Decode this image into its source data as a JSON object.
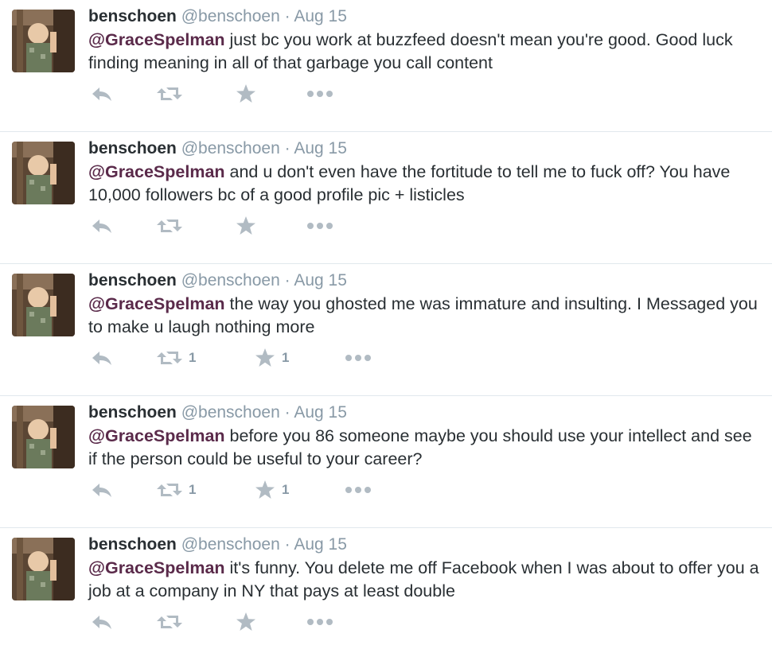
{
  "tweets": [
    {
      "fullname": "benschoen",
      "username": "@benschoen",
      "separator": "·",
      "time": "Aug 15",
      "mention": "@GraceSpelman",
      "text": " just bc you work at buzzfeed doesn't mean you're good. Good luck finding meaning in all of that garbage you call content",
      "retweet_count": "",
      "favorite_count": ""
    },
    {
      "fullname": "benschoen",
      "username": "@benschoen",
      "separator": "·",
      "time": "Aug 15",
      "mention": "@GraceSpelman",
      "text": " and u don't even have the fortitude to tell me to fuck off? You have 10,000 followers bc of a good profile pic + listicles",
      "retweet_count": "",
      "favorite_count": ""
    },
    {
      "fullname": "benschoen",
      "username": "@benschoen",
      "separator": "·",
      "time": "Aug 15",
      "mention": "@GraceSpelman",
      "text": " the way you ghosted me was immature and insulting. I Messaged you to make u laugh nothing more",
      "retweet_count": "1",
      "favorite_count": "1"
    },
    {
      "fullname": "benschoen",
      "username": "@benschoen",
      "separator": "·",
      "time": "Aug 15",
      "mention": "@GraceSpelman",
      "text": " before you 86 someone maybe you should use your intellect and see if the person could be useful to your career?",
      "retweet_count": "1",
      "favorite_count": "1"
    },
    {
      "fullname": "benschoen",
      "username": "@benschoen",
      "separator": "·",
      "time": "Aug 15",
      "mention": "@GraceSpelman",
      "text": " it's funny. You delete me off Facebook when I was about to offer you a job at a company in NY that pays at least double",
      "retweet_count": "",
      "favorite_count": ""
    }
  ],
  "icons": {
    "reply": "reply-icon",
    "retweet": "retweet-icon",
    "favorite": "star-icon",
    "more": "more-dots-icon"
  },
  "colors": {
    "mention": "#5a2a4a",
    "muted": "#8899a6",
    "icon": "#b1bbc3",
    "text": "#292f33"
  }
}
